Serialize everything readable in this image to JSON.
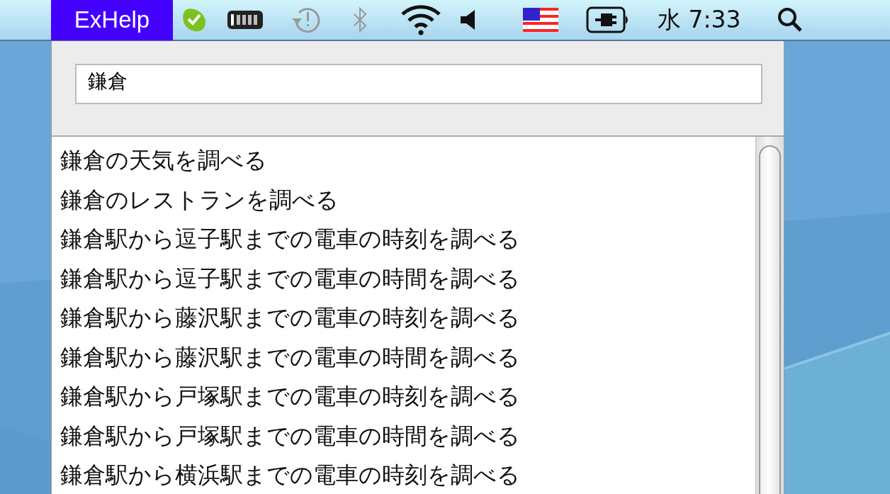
{
  "menu_bar": {
    "app_menu": {
      "label": "ExHelp",
      "selected": true
    },
    "clock": "水 7:33"
  },
  "search": {
    "value": "鎌倉"
  },
  "suggestions": [
    {
      "text": "鎌倉の天気を調べる"
    },
    {
      "text": "鎌倉のレストランを調べる"
    },
    {
      "text": "鎌倉駅から逗子駅までの電車の時刻を調べる"
    },
    {
      "text": "鎌倉駅から逗子駅までの電車の時間を調べる"
    },
    {
      "text": "鎌倉駅から藤沢駅までの電車の時刻を調べる"
    },
    {
      "text": "鎌倉駅から藤沢駅までの電車の時間を調べる"
    },
    {
      "text": "鎌倉駅から戸塚駅までの電車の時刻を調べる"
    },
    {
      "text": "鎌倉駅から戸塚駅までの電車の時間を調べる"
    },
    {
      "text": "鎌倉駅から横浜駅までの電車の時刻を調べる"
    }
  ]
}
